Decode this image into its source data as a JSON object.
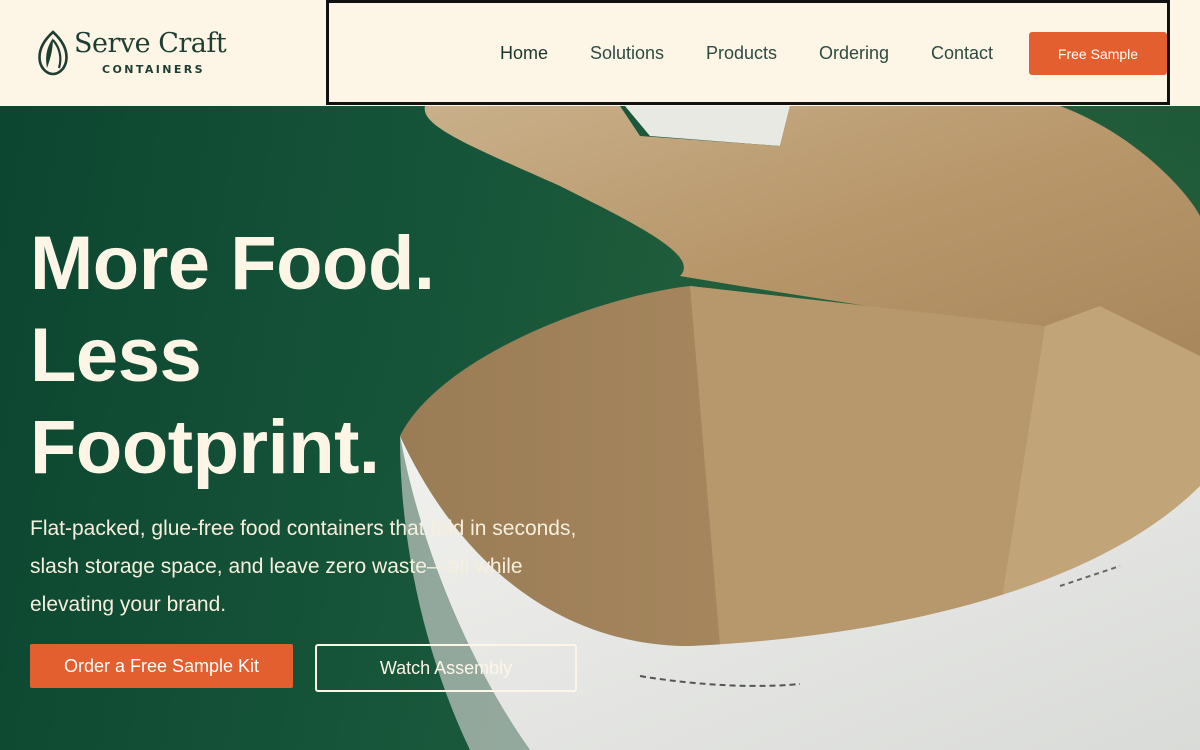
{
  "brand": {
    "name": "Serve Craft",
    "tagline": "CONTAINERS",
    "logo_icon": "leaf-icon"
  },
  "nav": {
    "items": [
      {
        "label": "Home",
        "active": true
      },
      {
        "label": "Solutions",
        "active": false
      },
      {
        "label": "Products",
        "active": false
      },
      {
        "label": "Ordering",
        "active": false
      },
      {
        "label": "Contact",
        "active": false
      }
    ],
    "cta_label": "Free Sample"
  },
  "hero": {
    "headline_lines": [
      "More Food.",
      "Less",
      "Footprint."
    ],
    "description": "Flat-packed, glue-free food containers that fold in seconds, slash storage space, and leave zero waste—all while elevating your brand.",
    "primary_cta": "Order a Free Sample Kit",
    "secondary_cta": "Watch Assembly",
    "image": "kraft-paper-food-container-photo"
  },
  "colors": {
    "header_bg": "#fdf6e6",
    "brand_green": "#1e3d33",
    "hero_green": "#16553a",
    "accent_orange": "#e35f2f",
    "cream_text": "#fdf6e6"
  }
}
